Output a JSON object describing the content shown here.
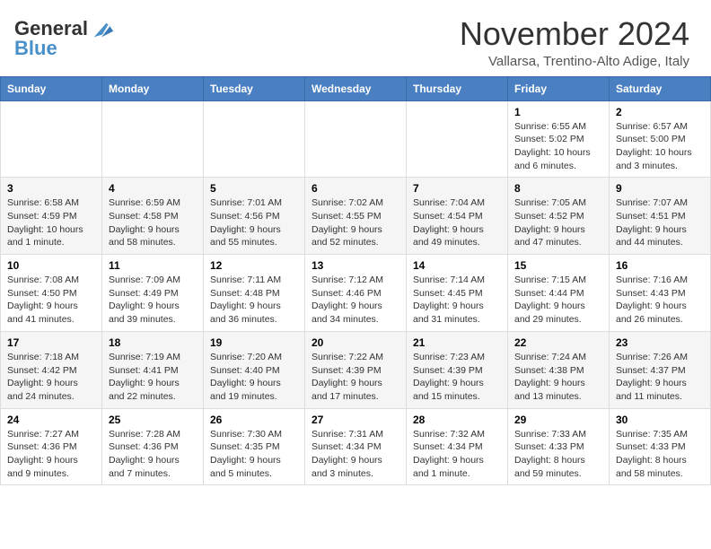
{
  "header": {
    "logo_line1": "General",
    "logo_line2": "Blue",
    "month_title": "November 2024",
    "subtitle": "Vallarsa, Trentino-Alto Adige, Italy"
  },
  "weekdays": [
    "Sunday",
    "Monday",
    "Tuesday",
    "Wednesday",
    "Thursday",
    "Friday",
    "Saturday"
  ],
  "weeks": [
    [
      {
        "day": "",
        "info": ""
      },
      {
        "day": "",
        "info": ""
      },
      {
        "day": "",
        "info": ""
      },
      {
        "day": "",
        "info": ""
      },
      {
        "day": "",
        "info": ""
      },
      {
        "day": "1",
        "info": "Sunrise: 6:55 AM\nSunset: 5:02 PM\nDaylight: 10 hours and 6 minutes."
      },
      {
        "day": "2",
        "info": "Sunrise: 6:57 AM\nSunset: 5:00 PM\nDaylight: 10 hours and 3 minutes."
      }
    ],
    [
      {
        "day": "3",
        "info": "Sunrise: 6:58 AM\nSunset: 4:59 PM\nDaylight: 10 hours and 1 minute."
      },
      {
        "day": "4",
        "info": "Sunrise: 6:59 AM\nSunset: 4:58 PM\nDaylight: 9 hours and 58 minutes."
      },
      {
        "day": "5",
        "info": "Sunrise: 7:01 AM\nSunset: 4:56 PM\nDaylight: 9 hours and 55 minutes."
      },
      {
        "day": "6",
        "info": "Sunrise: 7:02 AM\nSunset: 4:55 PM\nDaylight: 9 hours and 52 minutes."
      },
      {
        "day": "7",
        "info": "Sunrise: 7:04 AM\nSunset: 4:54 PM\nDaylight: 9 hours and 49 minutes."
      },
      {
        "day": "8",
        "info": "Sunrise: 7:05 AM\nSunset: 4:52 PM\nDaylight: 9 hours and 47 minutes."
      },
      {
        "day": "9",
        "info": "Sunrise: 7:07 AM\nSunset: 4:51 PM\nDaylight: 9 hours and 44 minutes."
      }
    ],
    [
      {
        "day": "10",
        "info": "Sunrise: 7:08 AM\nSunset: 4:50 PM\nDaylight: 9 hours and 41 minutes."
      },
      {
        "day": "11",
        "info": "Sunrise: 7:09 AM\nSunset: 4:49 PM\nDaylight: 9 hours and 39 minutes."
      },
      {
        "day": "12",
        "info": "Sunrise: 7:11 AM\nSunset: 4:48 PM\nDaylight: 9 hours and 36 minutes."
      },
      {
        "day": "13",
        "info": "Sunrise: 7:12 AM\nSunset: 4:46 PM\nDaylight: 9 hours and 34 minutes."
      },
      {
        "day": "14",
        "info": "Sunrise: 7:14 AM\nSunset: 4:45 PM\nDaylight: 9 hours and 31 minutes."
      },
      {
        "day": "15",
        "info": "Sunrise: 7:15 AM\nSunset: 4:44 PM\nDaylight: 9 hours and 29 minutes."
      },
      {
        "day": "16",
        "info": "Sunrise: 7:16 AM\nSunset: 4:43 PM\nDaylight: 9 hours and 26 minutes."
      }
    ],
    [
      {
        "day": "17",
        "info": "Sunrise: 7:18 AM\nSunset: 4:42 PM\nDaylight: 9 hours and 24 minutes."
      },
      {
        "day": "18",
        "info": "Sunrise: 7:19 AM\nSunset: 4:41 PM\nDaylight: 9 hours and 22 minutes."
      },
      {
        "day": "19",
        "info": "Sunrise: 7:20 AM\nSunset: 4:40 PM\nDaylight: 9 hours and 19 minutes."
      },
      {
        "day": "20",
        "info": "Sunrise: 7:22 AM\nSunset: 4:39 PM\nDaylight: 9 hours and 17 minutes."
      },
      {
        "day": "21",
        "info": "Sunrise: 7:23 AM\nSunset: 4:39 PM\nDaylight: 9 hours and 15 minutes."
      },
      {
        "day": "22",
        "info": "Sunrise: 7:24 AM\nSunset: 4:38 PM\nDaylight: 9 hours and 13 minutes."
      },
      {
        "day": "23",
        "info": "Sunrise: 7:26 AM\nSunset: 4:37 PM\nDaylight: 9 hours and 11 minutes."
      }
    ],
    [
      {
        "day": "24",
        "info": "Sunrise: 7:27 AM\nSunset: 4:36 PM\nDaylight: 9 hours and 9 minutes."
      },
      {
        "day": "25",
        "info": "Sunrise: 7:28 AM\nSunset: 4:36 PM\nDaylight: 9 hours and 7 minutes."
      },
      {
        "day": "26",
        "info": "Sunrise: 7:30 AM\nSunset: 4:35 PM\nDaylight: 9 hours and 5 minutes."
      },
      {
        "day": "27",
        "info": "Sunrise: 7:31 AM\nSunset: 4:34 PM\nDaylight: 9 hours and 3 minutes."
      },
      {
        "day": "28",
        "info": "Sunrise: 7:32 AM\nSunset: 4:34 PM\nDaylight: 9 hours and 1 minute."
      },
      {
        "day": "29",
        "info": "Sunrise: 7:33 AM\nSunset: 4:33 PM\nDaylight: 8 hours and 59 minutes."
      },
      {
        "day": "30",
        "info": "Sunrise: 7:35 AM\nSunset: 4:33 PM\nDaylight: 8 hours and 58 minutes."
      }
    ]
  ]
}
